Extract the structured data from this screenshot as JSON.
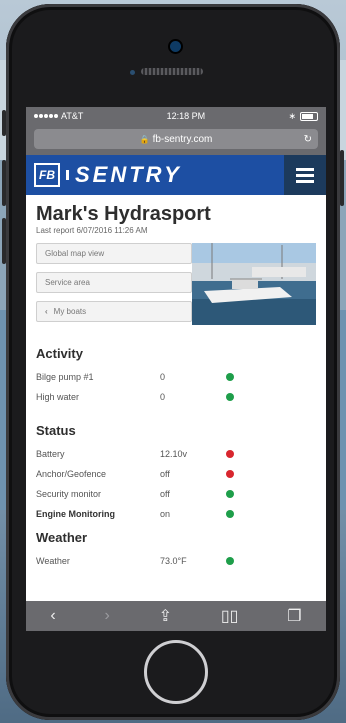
{
  "status_bar": {
    "carrier": "AT&T",
    "time": "12:18 PM",
    "battery_icon": "battery-icon"
  },
  "browser": {
    "url": "fb-sentry.com",
    "lock_icon": "lock-icon",
    "reload_icon": "reload-icon"
  },
  "brand": {
    "logo_mark": "FB",
    "logo_text": "SENTRY",
    "bar_color": "#1d4fa3",
    "menu_icon": "hamburger-menu-icon"
  },
  "boat": {
    "name": "Mark's Hydrasport",
    "last_report": "Last report 6/07/2016 11:26 AM"
  },
  "nav_buttons": [
    {
      "label": "Global map view"
    },
    {
      "label": "Service area"
    },
    {
      "label": "My boats",
      "icon": "chevron-left-icon"
    }
  ],
  "activity": {
    "title": "Activity",
    "rows": [
      {
        "label": "Bilge pump #1",
        "value": "0",
        "status_color": "#1e9e4a"
      },
      {
        "label": "High water",
        "value": "0",
        "status_color": "#1e9e4a"
      }
    ]
  },
  "status": {
    "title": "Status",
    "rows": [
      {
        "label": "Battery",
        "value": "12.10v",
        "status_color": "#d8262e"
      },
      {
        "label": "Anchor/Geofence",
        "value": "off",
        "status_color": "#d8262e"
      },
      {
        "label": "Security monitor",
        "value": "off",
        "status_color": "#1e9e4a"
      },
      {
        "label": "Engine Monitoring",
        "value": "on",
        "status_color": "#1e9e4a"
      }
    ]
  },
  "weather": {
    "title": "Weather",
    "rows": [
      {
        "label": "Weather",
        "value": "73.0°F",
        "status_color": "#1e9e4a"
      }
    ]
  },
  "toolbar": {
    "back_icon": "back-arrow-icon",
    "forward_icon": "forward-arrow-icon",
    "share_icon": "share-icon",
    "bookmarks_icon": "bookmarks-icon",
    "tabs_icon": "tabs-icon"
  }
}
